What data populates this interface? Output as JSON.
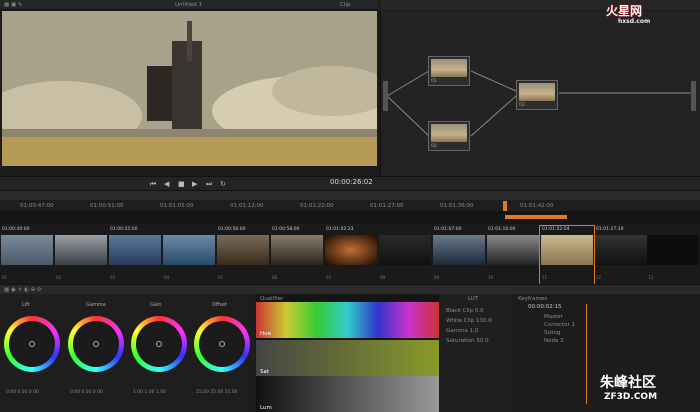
{
  "viewer": {
    "title": "Untitled 1",
    "mode": "Clip",
    "timecode": "00:00:26:02"
  },
  "node_graph": {
    "title": "",
    "nodes": [
      {
        "label": "01"
      },
      {
        "label": "02"
      },
      {
        "label": "03"
      }
    ]
  },
  "timeline": {
    "ruler": [
      "01:00:47:00",
      "01:00:51:00",
      "01:01:05:00",
      "01:01:12:00",
      "01:01:22:00",
      "01:01:27:00",
      "01:01:36:00",
      "01:01:42:00"
    ],
    "clips": [
      {
        "tc": "01:00:40:00",
        "n": "01"
      },
      {
        "tc": "",
        "n": "02"
      },
      {
        "tc": "01:00:55:00",
        "n": "03"
      },
      {
        "tc": "",
        "n": "04"
      },
      {
        "tc": "01:00:56:00",
        "n": "05"
      },
      {
        "tc": "01:00:58:00",
        "n": "06"
      },
      {
        "tc": "01:01:02:23",
        "n": "07"
      },
      {
        "tc": "",
        "n": "08"
      },
      {
        "tc": "01:01:07:00",
        "n": "09"
      },
      {
        "tc": "01:01:10:00",
        "n": "10"
      },
      {
        "tc": "01:01:02:04",
        "n": "11"
      },
      {
        "tc": "01:01:27:10",
        "n": "12"
      },
      {
        "tc": "",
        "n": "13"
      }
    ]
  },
  "wheels": {
    "labels": [
      "Lift",
      "Gamma",
      "Gain",
      "Offset"
    ],
    "values": [
      "0.00 0.00 0.00",
      "0.00 0.00 0.00",
      "1.00 1.00 1.00",
      "25.00 25.00 25.00"
    ]
  },
  "curves": {
    "title": "Qualifier",
    "rows": [
      "Hue",
      "Sat",
      "Lum"
    ]
  },
  "info": {
    "title": "LUT",
    "items": [
      "Black Clip 0.0",
      "White Clip 100.0",
      "Gamma 1.0",
      "Saturation 50.0"
    ]
  },
  "keyframes": {
    "title": "Keyframes",
    "timecode": "00:00:02:15",
    "tracks": [
      "Master",
      "Corrector 1",
      "Sizing",
      "Node 2"
    ]
  },
  "watermark": {
    "site": "火星网",
    "url": "hxsd.com",
    "brand": "朱峰社区",
    "domain": "ZF3D.COM"
  }
}
